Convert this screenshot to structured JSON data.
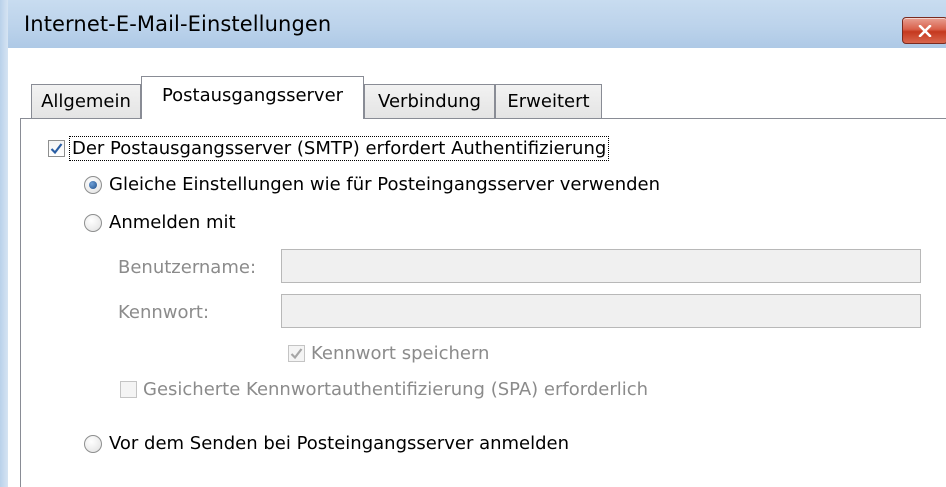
{
  "window": {
    "title": "Internet-E-Mail-Einstellungen",
    "close_icon": "close-x-icon"
  },
  "tabs": [
    {
      "label": "Allgemein",
      "active": false
    },
    {
      "label": "Postausgangsserver",
      "active": true
    },
    {
      "label": "Verbindung",
      "active": false
    },
    {
      "label": "Erweitert",
      "active": false
    }
  ],
  "smtp_auth": {
    "label": "Der Postausgangsserver (SMTP) erfordert Authentifizierung",
    "checked": true
  },
  "options": {
    "same_settings": {
      "label": "Gleiche Einstellungen wie für Posteingangsserver verwenden",
      "selected": true
    },
    "login_with": {
      "label": "Anmelden mit",
      "selected": false
    },
    "before_send": {
      "label": "Vor dem Senden bei Posteingangsserver anmelden",
      "selected": false
    }
  },
  "credentials": {
    "username_label": "Benutzername:",
    "username_value": "",
    "password_label": "Kennwort:",
    "password_value": "",
    "save_password_label": "Kennwort speichern",
    "save_password_checked": true,
    "spa_label": "Gesicherte Kennwortauthentifizierung (SPA) erforderlich",
    "spa_checked": false
  }
}
